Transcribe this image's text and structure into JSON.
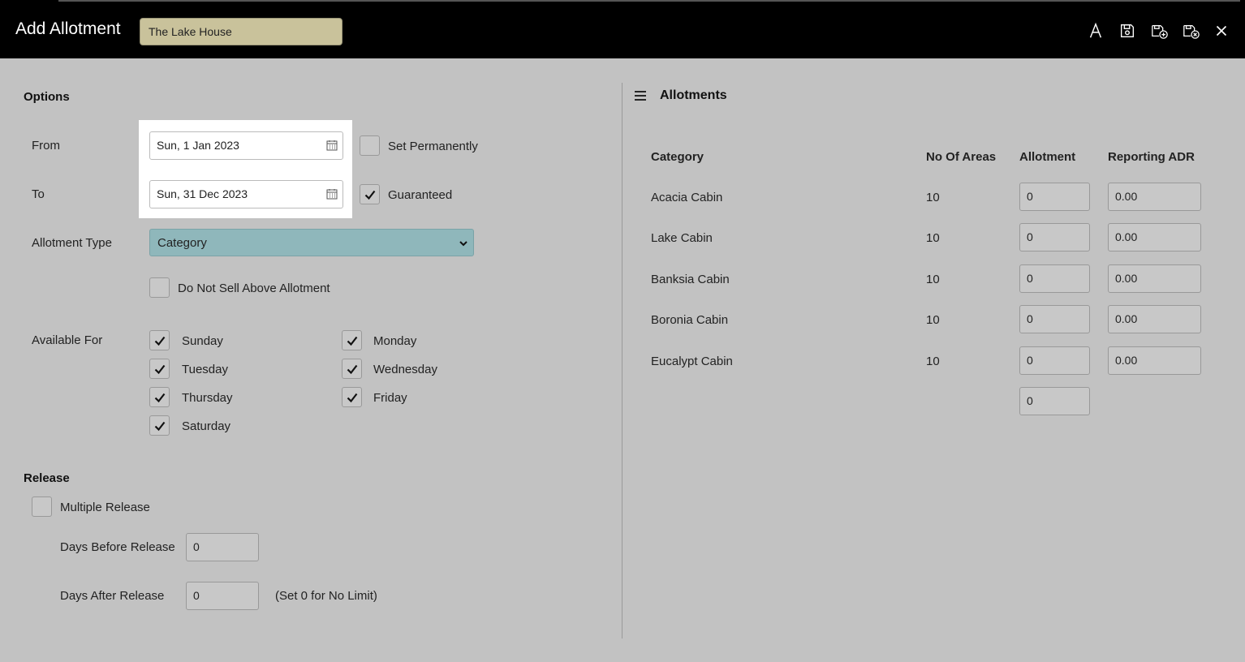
{
  "header": {
    "title": "Add Allotment",
    "property": "The Lake House",
    "icons": [
      "font-icon",
      "save-icon",
      "save-and-new-icon",
      "save-and-close-icon",
      "close-icon"
    ]
  },
  "options": {
    "section_title": "Options",
    "from_label": "From",
    "from_value": "Sun, 1 Jan 2023",
    "to_label": "To",
    "to_value": "Sun, 31 Dec 2023",
    "set_permanently_label": "Set Permanently",
    "set_permanently_checked": false,
    "guaranteed_label": "Guaranteed",
    "guaranteed_checked": true,
    "allotment_type_label": "Allotment Type",
    "allotment_type_value": "Category",
    "do_not_sell_label": "Do Not Sell Above Allotment",
    "do_not_sell_checked": false,
    "available_for_label": "Available For",
    "days": [
      {
        "label": "Sunday",
        "checked": true
      },
      {
        "label": "Monday",
        "checked": true
      },
      {
        "label": "Tuesday",
        "checked": true
      },
      {
        "label": "Wednesday",
        "checked": true
      },
      {
        "label": "Thursday",
        "checked": true
      },
      {
        "label": "Friday",
        "checked": true
      },
      {
        "label": "Saturday",
        "checked": true
      }
    ]
  },
  "release": {
    "section_title": "Release",
    "multiple_release_label": "Multiple Release",
    "multiple_release_checked": false,
    "days_before_label": "Days Before Release",
    "days_before_value": "0",
    "days_after_label": "Days After Release",
    "days_after_value": "0",
    "hint": "(Set 0 for No Limit)"
  },
  "allotments": {
    "title": "Allotments",
    "columns": [
      "Category",
      "No Of Areas",
      "Allotment",
      "Reporting ADR"
    ],
    "rows": [
      {
        "category": "Acacia Cabin",
        "areas": "10",
        "allotment": "0",
        "adr": "0.00"
      },
      {
        "category": "Lake Cabin",
        "areas": "10",
        "allotment": "0",
        "adr": "0.00"
      },
      {
        "category": "Banksia Cabin",
        "areas": "10",
        "allotment": "0",
        "adr": "0.00"
      },
      {
        "category": "Boronia Cabin",
        "areas": "10",
        "allotment": "0",
        "adr": "0.00"
      },
      {
        "category": "Eucalypt Cabin",
        "areas": "10",
        "allotment": "0",
        "adr": "0.00"
      }
    ],
    "total_allotment": "0"
  }
}
